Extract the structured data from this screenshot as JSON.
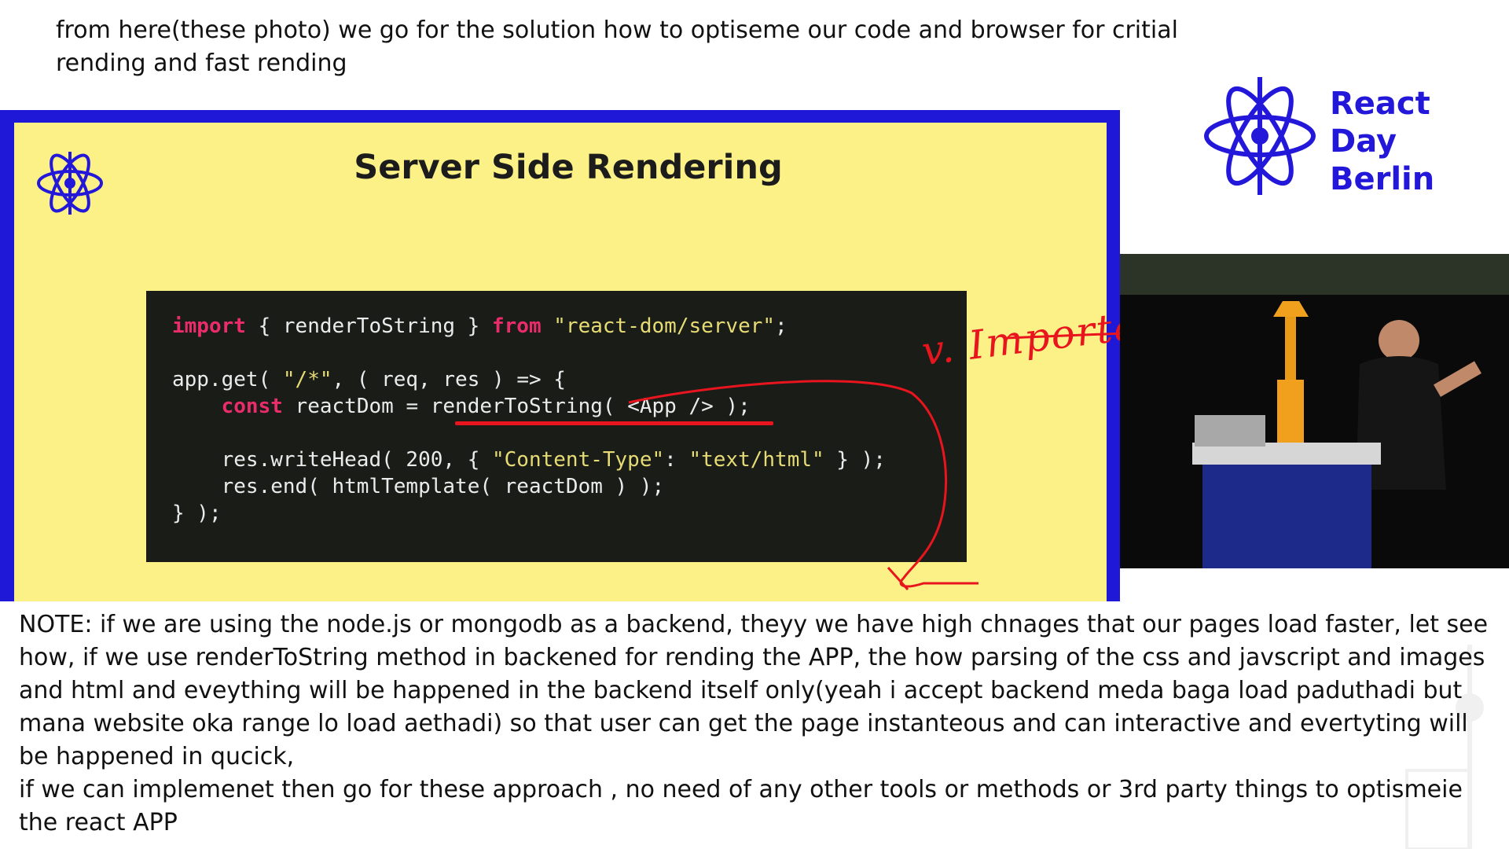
{
  "notes": {
    "top": "from here(these photo) we go for the solution how to optiseme our code and browser for critial rending and fast rending",
    "bottom_para1": "NOTE: if we are using the node.js or mongodb as a backend, theyy we have high chnages that our pages load faster, let see how, if we use renderToString method in backened for rending the APP, the how parsing of the css and javscript and images and html and eveything will be happened in the backend itself only(yeah i accept backend meda baga load paduthadi but mana website oka range lo load aethadi) so that user can get the page instanteous and can interactive and evertyting will be happened in qucick,",
    "bottom_para2": "if we can implemenet then go for these approach , no need of any other tools or methods or 3rd party things to optismeie the react APP"
  },
  "slide": {
    "title": "Server Side Rendering",
    "code": {
      "l1_kw1": "import",
      "l1_mid": " { renderToString } ",
      "l1_kw2": "from",
      "l1_str": "\"react-dom/server\"",
      "l1_end": ";",
      "l3": "app.get( ",
      "l3_str": "\"/*\"",
      "l3_end": ", ( req, res ) => {",
      "l4_kw": "const",
      "l4_rest": " reactDom = renderToString( <App /> );",
      "l6_a": "res.writeHead( 200, { ",
      "l6_str1": "\"Content-Type\"",
      "l6_b": ": ",
      "l6_str2": "\"text/html\"",
      "l6_c": " } );",
      "l7": "res.end( htmlTemplate( reactDom ) );",
      "l8": "} );"
    }
  },
  "annotation": {
    "text": "v. Important",
    "color": "#e8141e"
  },
  "brand": {
    "line1": "React",
    "line2": "Day",
    "line3": "Berlin",
    "color": "#2318d9"
  },
  "colors": {
    "slide_bg": "#fbf186",
    "frame": "#1f18d6",
    "code_bg": "#1a1d17",
    "keyword": "#ea2d6a",
    "string": "#e6db74"
  }
}
